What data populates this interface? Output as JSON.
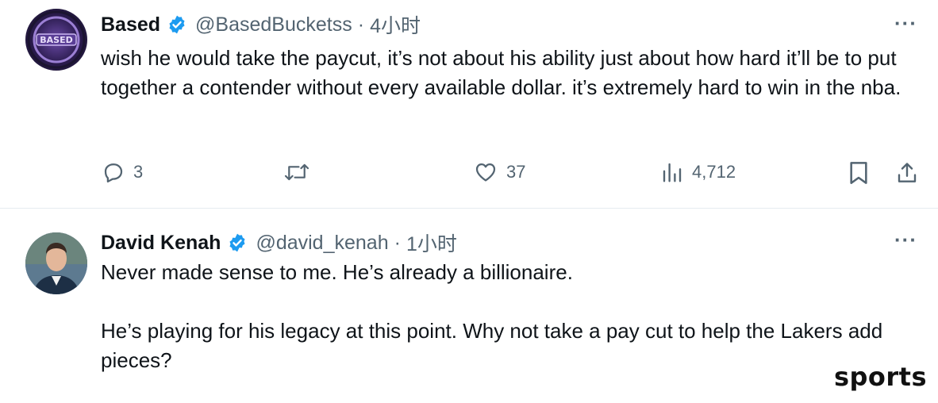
{
  "tweets": [
    {
      "author": {
        "name": "Based",
        "handle": "@BasedBucketss",
        "verified": true,
        "avatar_icon": "team-logo-avatar"
      },
      "separator": "·",
      "time": "4小时",
      "more_icon": "more-dots-icon",
      "more_label": "···",
      "text": [
        "wish he would take the paycut, it’s not about his ability just about how hard it’ll be to put together a contender without every available dollar. it’s extremely hard to win in the nba."
      ],
      "actions": {
        "reply": {
          "icon": "reply-icon",
          "count": "3"
        },
        "retweet": {
          "icon": "retweet-icon",
          "count": ""
        },
        "like": {
          "icon": "like-icon",
          "count": "37"
        },
        "views": {
          "icon": "views-icon",
          "count": "4,712"
        },
        "bookmark": {
          "icon": "bookmark-icon"
        },
        "share": {
          "icon": "share-icon"
        }
      }
    },
    {
      "author": {
        "name": "David Kenah",
        "handle": "@david_kenah",
        "verified": true,
        "avatar_icon": "profile-photo-avatar"
      },
      "separator": "·",
      "time": "1小时",
      "more_icon": "more-dots-icon",
      "more_label": "···",
      "text": [
        "Never made sense to me. He’s already a billionaire.",
        "He’s playing for his legacy at this point. Why not take a pay cut to help the Lakers add pieces?"
      ]
    }
  ],
  "watermark": "sports",
  "colors": {
    "verified": "#1d9bf0",
    "text": "#0f1419",
    "secondary": "#536471",
    "divider": "#e6ecf0"
  }
}
